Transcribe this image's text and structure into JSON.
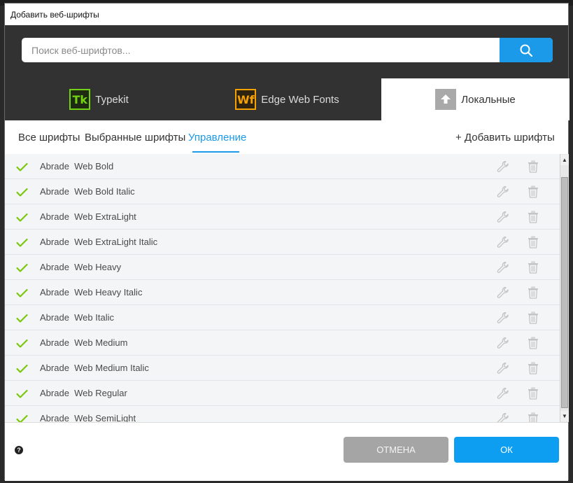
{
  "window": {
    "title": "Добавить веб-шрифты"
  },
  "search": {
    "placeholder": "Поиск веб-шрифтов..."
  },
  "tabs": [
    {
      "badge": "Tk",
      "label": "Typekit",
      "active": false
    },
    {
      "badge": "Wf",
      "label": "Edge Web Fonts",
      "active": false
    },
    {
      "badge": "upload-icon",
      "label": "Локальные",
      "active": true
    }
  ],
  "subnav": {
    "all": "Все шрифты",
    "selected": "Выбранные шрифты",
    "manage": "Управление",
    "add": "+ Добавить шрифты"
  },
  "fonts": [
    "Abrade  Web Bold",
    "Abrade  Web Bold Italic",
    "Abrade  Web ExtraLight",
    "Abrade  Web ExtraLight Italic",
    "Abrade  Web Heavy",
    "Abrade  Web Heavy Italic",
    "Abrade  Web Italic",
    "Abrade  Web Medium",
    "Abrade  Web Medium Italic",
    "Abrade  Web Regular",
    "Abrade  Web SemiLight"
  ],
  "footer": {
    "help": "?",
    "cancel_label": "ОТМЕНА",
    "ok_label": "ОК"
  },
  "colors": {
    "accent": "#1b9ae9",
    "check": "#7ac70c",
    "header_bg": "#323232"
  }
}
